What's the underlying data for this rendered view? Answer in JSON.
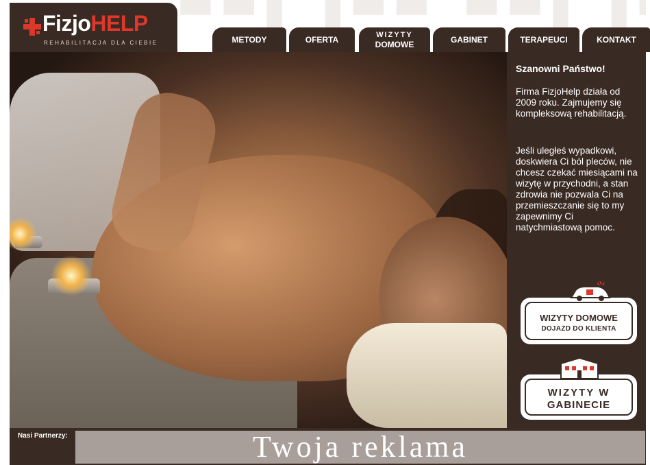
{
  "brand": {
    "name_part1": "Fizjo",
    "name_part2": "HELP",
    "tagline": "REHABILITACJA DLA CIEBIE",
    "accent_color": "#e0372b",
    "bg_color": "#3a2a24"
  },
  "nav": {
    "items": [
      {
        "label": "METODY"
      },
      {
        "label": "OFERTA"
      },
      {
        "label_line1": "WIZYTY",
        "label_line2": "DOMOWE"
      },
      {
        "label": "GABINET"
      },
      {
        "label": "TERAPEUCI"
      },
      {
        "label": "KONTAKT"
      }
    ]
  },
  "sidebar": {
    "greeting": "Szanowni Państwo!",
    "paragraph1": "Firma FizjoHelp działa od 2009 roku. Zajmujemy się kompleksową rehabilitacją.",
    "paragraph2": "Jeśli uległeś wypadkowi, doskwiera Ci ból pleców, nie chcesz czekać miesiącami na wizytę w przychodni, a stan zdrowia nie pozwala Ci na przemieszczanie się to my zapewnimy Ci natychmiastową pomoc.",
    "badge_home": {
      "line1": "WIZYTY DOMOWE",
      "line2": "DOJAZD DO KLIENTA",
      "icon": "car-icon"
    },
    "badge_office": {
      "line1": "WIZYTY W",
      "line2": "GABINECIE",
      "icon": "building-icon"
    }
  },
  "footer": {
    "partners_label": "Nasi Partnerzy:",
    "ad_text": "Twoja reklama"
  }
}
